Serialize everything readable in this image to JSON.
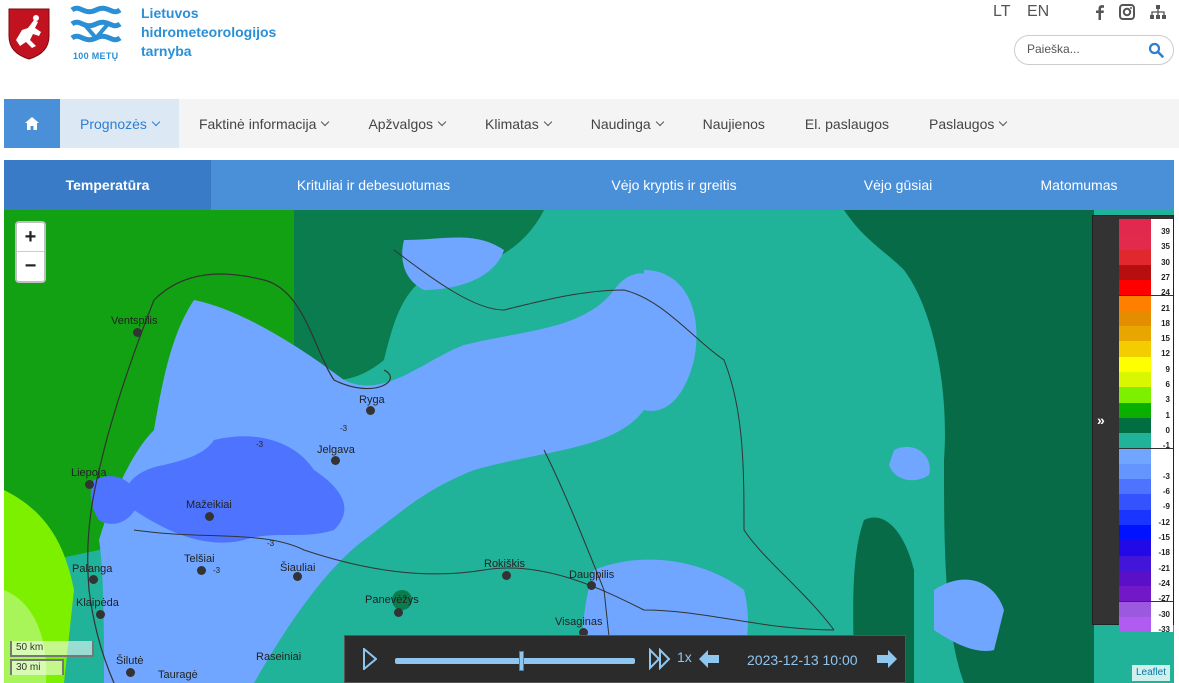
{
  "header": {
    "org_line1": "Lietuvos",
    "org_line2": "hidrometeorologijos",
    "org_line3": "tarnyba",
    "years_badge": "100 METŲ",
    "lang_lt": "LT",
    "lang_en": "EN",
    "search_placeholder": "Paieška...",
    "brand_color": "#2b8fd6"
  },
  "nav": {
    "items": [
      {
        "label": "Prognozės",
        "dropdown": true,
        "active": true
      },
      {
        "label": "Faktinė informacija",
        "dropdown": true
      },
      {
        "label": "Apžvalgos",
        "dropdown": true
      },
      {
        "label": "Klimatas",
        "dropdown": true
      },
      {
        "label": "Naudinga",
        "dropdown": true
      },
      {
        "label": "Naujienos",
        "dropdown": false
      },
      {
        "label": "El. paslaugos",
        "dropdown": false
      },
      {
        "label": "Paslaugos",
        "dropdown": true
      }
    ]
  },
  "tabs": [
    {
      "label": "Temperatūra",
      "active": true
    },
    {
      "label": "Krituliai ir debesuotumas"
    },
    {
      "label": "Vėjo kryptis ir greitis"
    },
    {
      "label": "Vėjo gūsiai"
    },
    {
      "label": "Matomumas"
    }
  ],
  "map": {
    "zoom_in": "+",
    "zoom_out": "−",
    "scale_km": "50 km",
    "scale_mi": "30 mi",
    "attribution": "Leaflet",
    "cities": [
      "Ventspilis",
      "Ryga",
      "Jelgava",
      "Liepoja",
      "Mažeikiai",
      "Telšiai",
      "Šiauliai",
      "Palanga",
      "Klaipėda",
      "Panevėžys",
      "Rokiškis",
      "Daugpilis",
      "Visaginas",
      "Šilutė",
      "Tauragė",
      "Raseiniai"
    ],
    "isolines": [
      "-3",
      "-3",
      "-3",
      "-3"
    ]
  },
  "legend": {
    "toggle_icon": "»",
    "entries": [
      {
        "label": "39",
        "color": "#e3284f"
      },
      {
        "label": "35",
        "color": "#e12a4c"
      },
      {
        "label": "30",
        "color": "#e0282e"
      },
      {
        "label": "27",
        "color": "#b70f0f"
      },
      {
        "label": "24",
        "color": "#ff0000"
      },
      {
        "label": "21",
        "color": "#ff7f00"
      },
      {
        "label": "18",
        "color": "#e48d00"
      },
      {
        "label": "15",
        "color": "#e9a600"
      },
      {
        "label": "12",
        "color": "#f4cd00"
      },
      {
        "label": "9",
        "color": "#ffff00"
      },
      {
        "label": "6",
        "color": "#d9f700"
      },
      {
        "label": "3",
        "color": "#7df000"
      },
      {
        "label": "1",
        "color": "#09b000"
      },
      {
        "label": "0",
        "color": "#006e40"
      },
      {
        "label": "-1",
        "color": "#21b29a"
      },
      {
        "label": "",
        "color": "#70a6ff"
      },
      {
        "label": "-3",
        "color": "#6495ff"
      },
      {
        "label": "-6",
        "color": "#4e74ff"
      },
      {
        "label": "-9",
        "color": "#3453ff"
      },
      {
        "label": "-12",
        "color": "#1a35ff"
      },
      {
        "label": "-15",
        "color": "#0012ff"
      },
      {
        "label": "-18",
        "color": "#2109e8"
      },
      {
        "label": "-21",
        "color": "#4215d9"
      },
      {
        "label": "-24",
        "color": "#5a0fc9"
      },
      {
        "label": "-27",
        "color": "#7218c8"
      },
      {
        "label": "-30",
        "color": "#9b59e0"
      },
      {
        "label": "-33",
        "color": "#b05cf0"
      }
    ]
  },
  "player": {
    "speed": "1x",
    "datetime": "2023-12-13 10:00",
    "progress": 0.53
  }
}
